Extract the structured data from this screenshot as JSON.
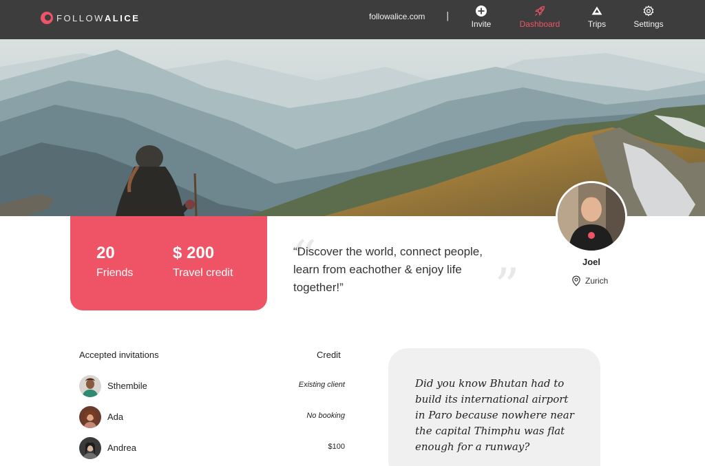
{
  "brand": {
    "logo_light": "FOLLOW",
    "logo_bold": "ALICE",
    "accent": "#ef5466"
  },
  "nav": {
    "domain": "followalice.com",
    "separator": "|",
    "items": [
      {
        "label": "Invite",
        "icon": "plus-circle-icon"
      },
      {
        "label": "Dashboard",
        "icon": "rocket-icon",
        "active": true
      },
      {
        "label": "Trips",
        "icon": "mountain-icon"
      },
      {
        "label": "Settings",
        "icon": "gear-icon"
      }
    ]
  },
  "stats": {
    "friends_value": "20",
    "friends_label": "Friends",
    "credit_value": "$ 200",
    "credit_label": "Travel credit"
  },
  "quote": {
    "text": "“Discover the world, connect people, learn from eachother & enjoy life together!”"
  },
  "profile": {
    "name": "Joel",
    "location": "Zurich"
  },
  "invitations": {
    "header_left": "Accepted invitations",
    "header_right": "Credit",
    "rows": [
      {
        "name": "Sthembile",
        "credit": "Existing client",
        "italic": true
      },
      {
        "name": "Ada",
        "credit": "No booking",
        "italic": true
      },
      {
        "name": "Andrea",
        "credit": "$100",
        "italic": false
      }
    ]
  },
  "fact": {
    "text": "Did you know Bhutan had to build its international airport in Paro because nowhere near the capital Thimphu was flat enough for a runway?"
  }
}
